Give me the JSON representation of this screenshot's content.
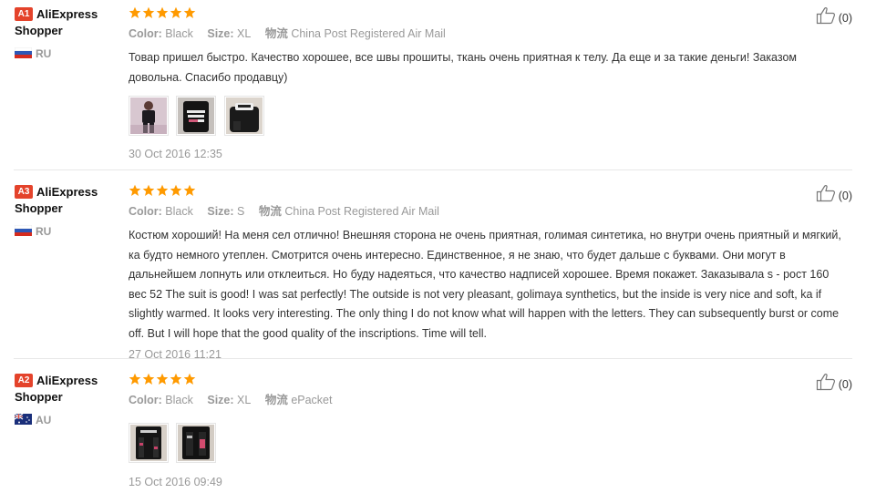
{
  "labels": {
    "color": "Color:",
    "size": "Size:",
    "shipping": "物流"
  },
  "reviews": [
    {
      "badge": "A1",
      "user_line1": "AliExpress",
      "user_line2": "Shopper",
      "country": "RU",
      "flag": "russia-flag",
      "rating": 5,
      "color": "Black",
      "size": "XL",
      "shipping": "China Post Registered Air Mail",
      "text": "Товар пришел быстро. Качество хорошее, все швы прошиты, ткань очень приятная к телу. Да еще и за такие деньги! Заказом довольна. Спасибо продавцу)",
      "photos": 3,
      "date": "30 Oct 2016 12:35",
      "helpful": "(0)"
    },
    {
      "badge": "A3",
      "user_line1": "AliExpress",
      "user_line2": "Shopper",
      "country": "RU",
      "flag": "russia-flag",
      "rating": 5,
      "color": "Black",
      "size": "S",
      "shipping": "China Post Registered Air Mail",
      "text": "Костюм хороший! На меня сел отлично! Внешняя сторона не очень приятная, голимая синтетика, но внутри очень приятный и мягкий, ка будто немного утеплен. Смотрится очень интересно. Единственное, я не знаю, что будет дальше с буквами. Они могут в дальнейшем лопнуть или отклеиться. Но буду надеяться, что качество надписей хорошее. Время покажет. Заказывала s - рост 160 вес 52 The suit is good! I was sat perfectly! The outside is not very pleasant, golimaya synthetics, but the inside is very nice and soft, ka if slightly warmed. It looks very interesting. The only thing I do not know what will happen with the letters. They can subsequently burst or come off. But I will hope that the good quality of the inscriptions. Time will tell.",
      "photos": 0,
      "date": "27 Oct 2016 11:21",
      "helpful": "(0)"
    },
    {
      "badge": "A2",
      "user_line1": "AliExpress",
      "user_line2": "Shopper",
      "country": "AU",
      "flag": "australia-flag",
      "rating": 5,
      "color": "Black",
      "size": "XL",
      "shipping": "ePacket",
      "text": "",
      "photos": 2,
      "date": "15 Oct 2016 09:49",
      "helpful": "(0)"
    }
  ],
  "colors": {
    "star": "#ff9a00",
    "badge": "#e4432b",
    "muted": "#999999"
  }
}
